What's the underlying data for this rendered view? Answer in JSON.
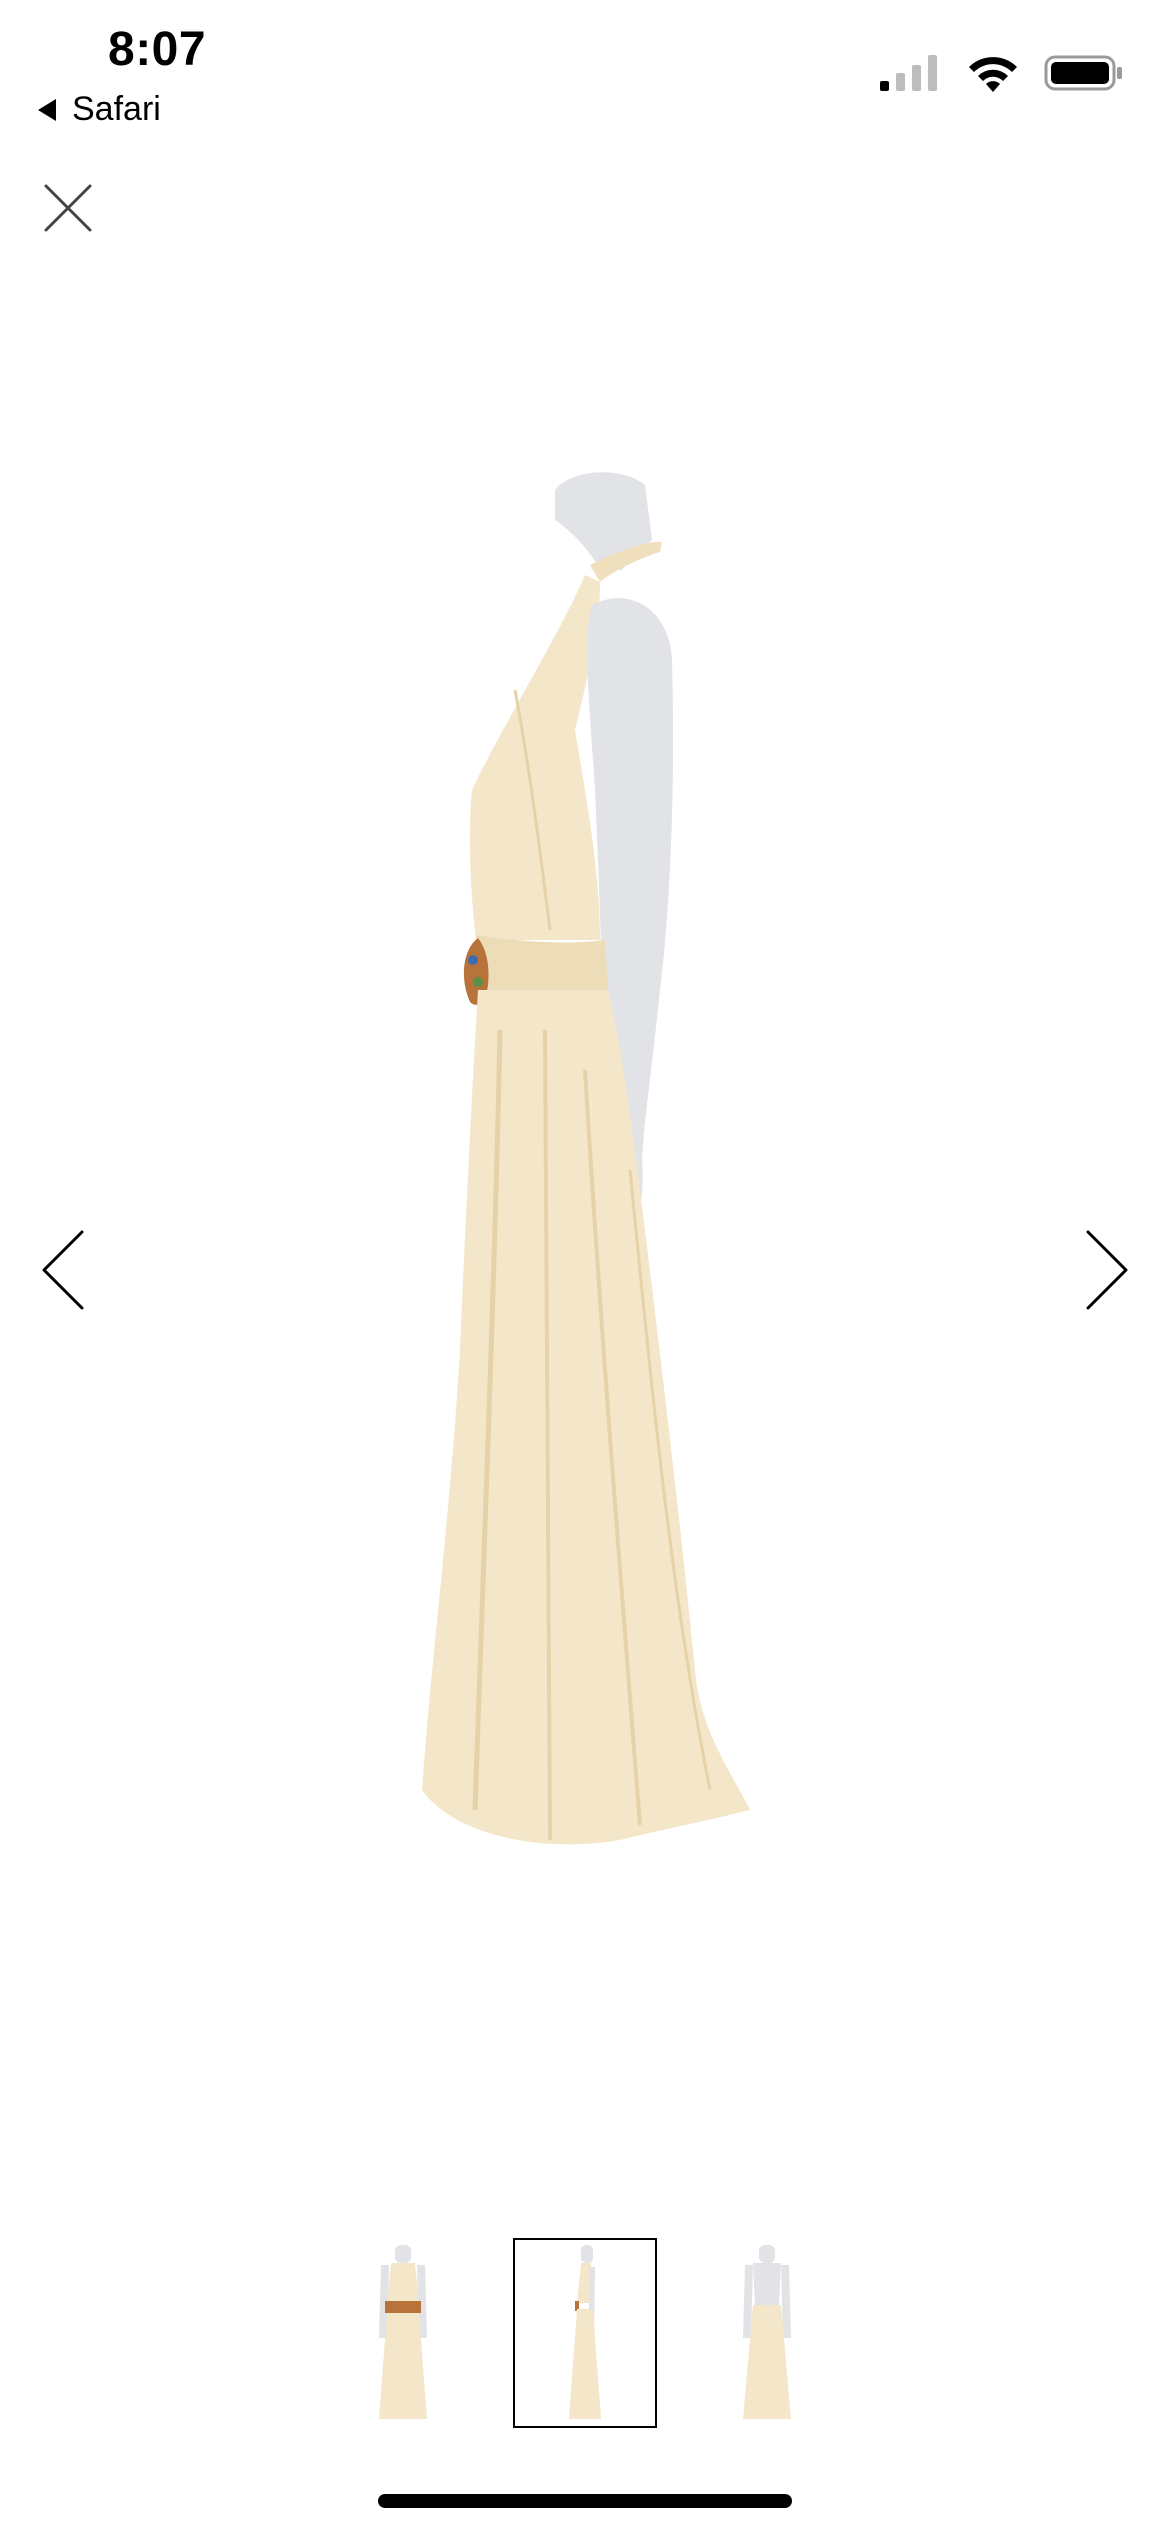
{
  "status_bar": {
    "time": "8:07",
    "back_app_label": "Safari",
    "icons": [
      "cellular-signal-icon",
      "wifi-icon",
      "battery-icon"
    ]
  },
  "viewer": {
    "close_icon": "close-icon",
    "prev_icon": "chevron-left-icon",
    "next_icon": "chevron-right-icon",
    "main_image_subject": "cream-satin-halter-gown-side-view",
    "thumbnails": [
      {
        "subject": "front-view",
        "selected": false
      },
      {
        "subject": "side-view",
        "selected": true
      },
      {
        "subject": "back-view",
        "selected": false
      }
    ]
  },
  "colors": {
    "background": "#ffffff",
    "gown": "#f4e6c8",
    "gown_shadow": "#e6d2a8",
    "mannequin": "#e2e3e6",
    "brooch": "#b8733a",
    "icon": "#000000"
  }
}
